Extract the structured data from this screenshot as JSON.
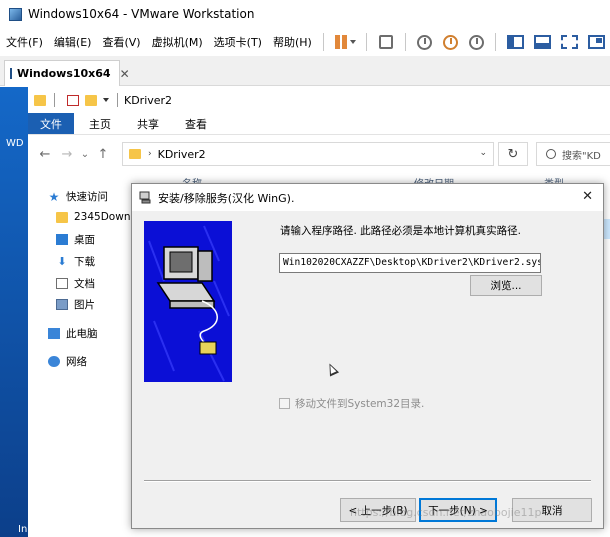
{
  "vm": {
    "title": "Windows10x64 - VMware Workstation",
    "menu": [
      "文件(F)",
      "编辑(E)",
      "查看(V)",
      "虚拟机(M)",
      "选项卡(T)",
      "帮助(H)"
    ],
    "tab_label": "Windows10x64",
    "tab_close": "✕"
  },
  "desktop": {
    "labels": [
      "WD",
      "In"
    ]
  },
  "explorer": {
    "title": "KDriver2",
    "ribbon": {
      "file": "文件",
      "tabs": [
        "主页",
        "共享",
        "查看"
      ]
    },
    "address": {
      "back": "←",
      "forward": "→",
      "history": "⌄",
      "up": "↑",
      "path": "KDriver2",
      "refresh": "↻",
      "search_placeholder": "搜索\"KD"
    },
    "columns": [
      "名称",
      "修改日期",
      "类型"
    ],
    "nav": [
      {
        "label": "快速访问",
        "icon": "star-icon"
      },
      {
        "label": "2345Downl",
        "icon": "folder-icon"
      },
      {
        "label": "桌面",
        "icon": "desktop-icon"
      },
      {
        "label": "下载",
        "icon": "download-icon"
      },
      {
        "label": "文档",
        "icon": "document-icon"
      },
      {
        "label": "图片",
        "icon": "pictures-icon"
      },
      {
        "label": "此电脑",
        "icon": "computer-icon"
      },
      {
        "label": "网络",
        "icon": "network-icon"
      }
    ]
  },
  "dialog": {
    "title": "安装/移除服务(汉化 WinG).",
    "close": "✕",
    "prompt": "请输入程序路径. 此路径必须是本地计算机真实路径.",
    "path_value": "Win102020CXAZZF\\Desktop\\KDriver2\\KDriver2.sys",
    "browse_label": "浏览...",
    "checkbox_label": "移动文件到System32目录.",
    "checkbox_checked": false,
    "buttons": {
      "back": "< 上一步(B)",
      "next": "下一步(N) >",
      "cancel": "取消"
    }
  },
  "watermark": "https://blog.csdn.net/zhaobojie11p"
}
